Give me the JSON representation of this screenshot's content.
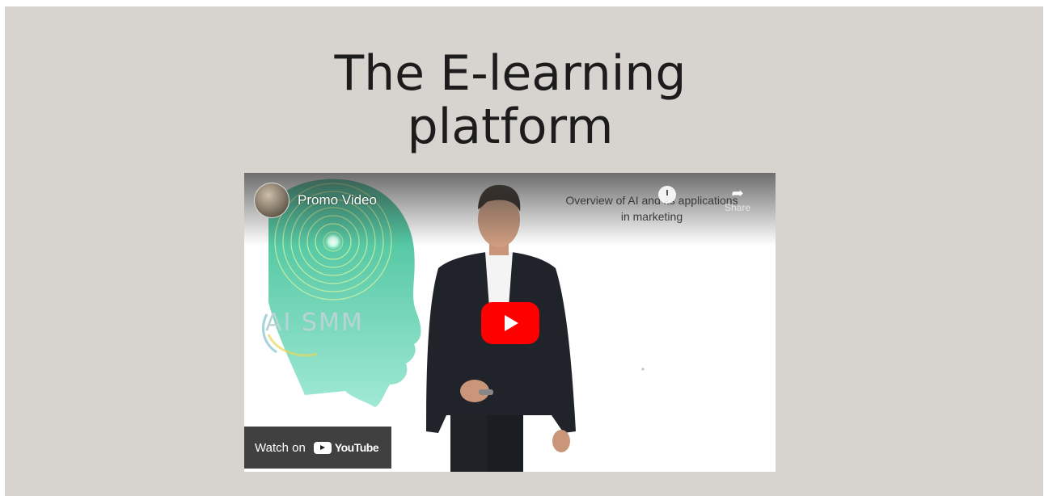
{
  "page": {
    "title_line1": "The E-learning",
    "title_line2": "platform"
  },
  "video": {
    "title": "Promo Video",
    "overlay_line1": "Overview of AI and its applications",
    "overlay_line2": "in marketing",
    "share_label": "Share",
    "watch_on_label": "Watch on",
    "youtube_label": "YouTube",
    "graphic_text": "AI SMM",
    "colors": {
      "play_button": "#ff0000",
      "head_gradient_start": "#2fb88c",
      "head_gradient_end": "#9be8d2"
    }
  }
}
